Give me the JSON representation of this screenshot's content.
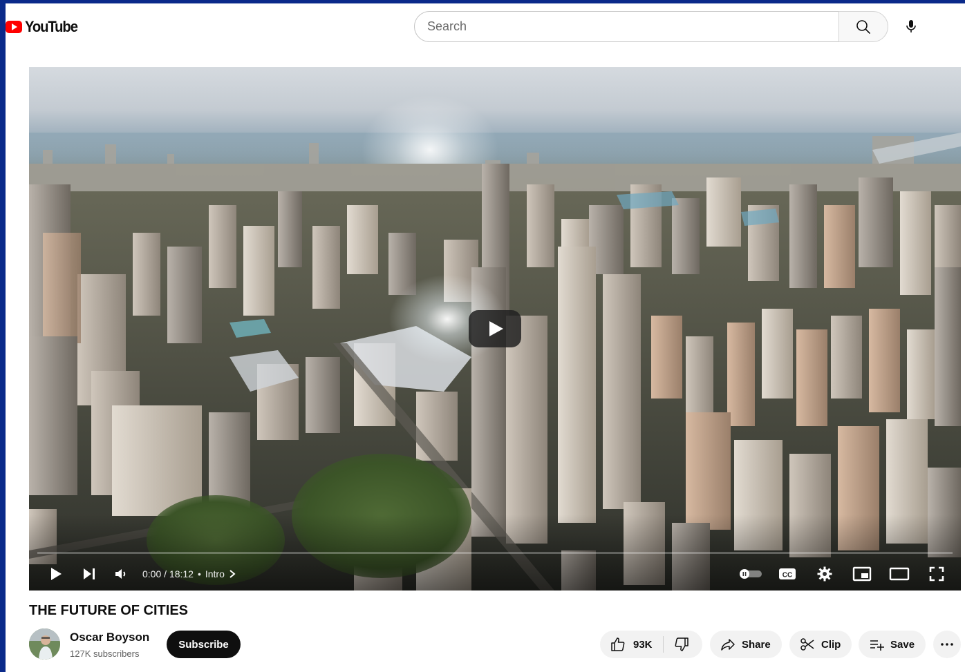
{
  "header": {
    "logo_text": "YouTube",
    "search_placeholder": "Search",
    "search_icon": "search-icon",
    "mic_icon": "mic-icon"
  },
  "player": {
    "current_time": "0:00",
    "duration": "18:12",
    "time_text": "0:00 / 18:12",
    "chapter": "Intro",
    "progress_fraction": 0.0,
    "icons": [
      "play-icon",
      "next-icon",
      "volume-icon",
      "autoplay-toggle",
      "cc-icon",
      "settings-icon",
      "miniplayer-icon",
      "theater-icon",
      "fullscreen-icon"
    ]
  },
  "video": {
    "title": "THE FUTURE OF CITIES",
    "channel_name": "Oscar Boyson",
    "subscribers": "127K subscribers",
    "subscribe_label": "Subscribe"
  },
  "actions": {
    "like_count": "93K",
    "share_label": "Share",
    "clip_label": "Clip",
    "save_label": "Save"
  },
  "colors": {
    "brand_red": "#ff0000",
    "frame_border": "#0a2a8a",
    "subscribe_bg": "#0f0f0f",
    "pill_bg": "#f2f2f2"
  }
}
